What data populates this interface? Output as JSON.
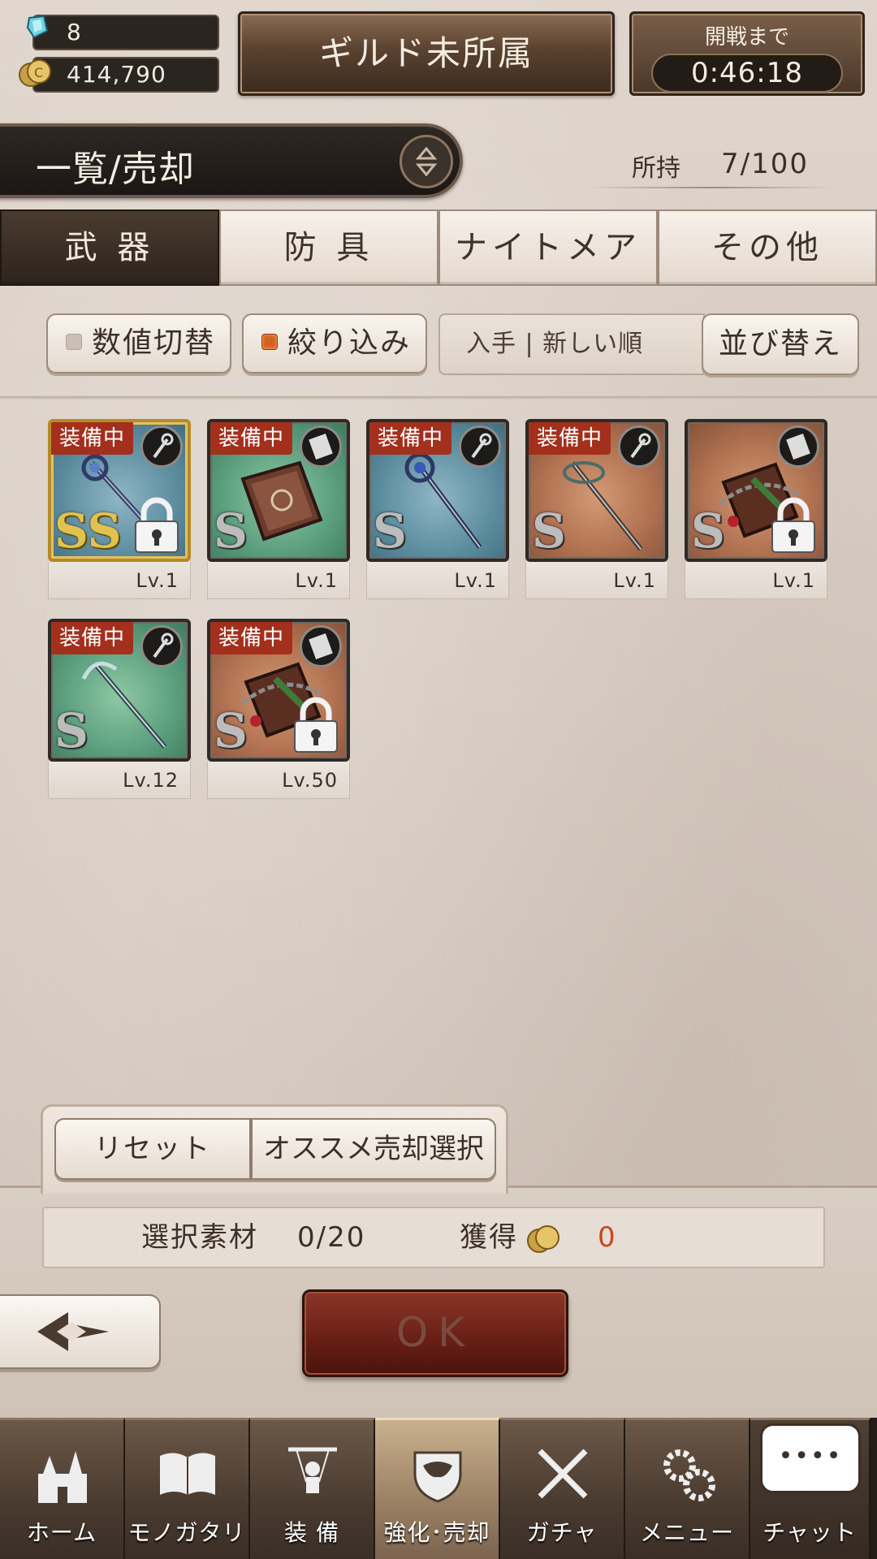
{
  "header": {
    "gems": "8",
    "gold": "414,790",
    "guild_status": "ギルド未所属",
    "battle_label": "開戦まで",
    "battle_timer": "0:46:18"
  },
  "title": {
    "text": "一覧/売却",
    "owned_label": "所持",
    "owned_value": "7/100"
  },
  "tabs": [
    {
      "label": "武 器",
      "active": true
    },
    {
      "label": "防 具",
      "active": false
    },
    {
      "label": "ナイトメア",
      "active": false
    },
    {
      "label": "その他",
      "active": false
    }
  ],
  "filters": {
    "value_toggle": "数値切替",
    "narrow": "絞り込み",
    "sort_field": "入手 | 新しい順",
    "sort_button": "並び替え"
  },
  "items": [
    {
      "equipped": "装備中",
      "rank": "SS",
      "level": "Lv.1",
      "bg": "blue",
      "locked": true,
      "type": "staff-icon"
    },
    {
      "equipped": "装備中",
      "rank": "S",
      "level": "Lv.1",
      "bg": "green",
      "locked": false,
      "type": "book-icon"
    },
    {
      "equipped": "装備中",
      "rank": "S",
      "level": "Lv.1",
      "bg": "blue",
      "locked": false,
      "type": "staff-icon"
    },
    {
      "equipped": "装備中",
      "rank": "S",
      "level": "Lv.1",
      "bg": "orange",
      "locked": false,
      "type": "staff-icon"
    },
    {
      "equipped": "",
      "rank": "S",
      "level": "Lv.1",
      "bg": "orange",
      "locked": true,
      "type": "book-icon"
    },
    {
      "equipped": "装備中",
      "rank": "S",
      "level": "Lv.12",
      "bg": "green",
      "locked": false,
      "type": "staff-icon"
    },
    {
      "equipped": "装備中",
      "rank": "S",
      "level": "Lv.50",
      "bg": "orange",
      "locked": true,
      "type": "book-icon"
    }
  ],
  "actions": {
    "reset": "リセット",
    "recommend": "オススメ売却選択"
  },
  "summary": {
    "selected_label": "選択素材",
    "selected_value": "0/20",
    "gain_label": "獲得",
    "gain_value": "0"
  },
  "ok_label": "OK",
  "nav": [
    {
      "label": "ホーム",
      "icon": "castle-icon",
      "active": false
    },
    {
      "label": "モノガタリ",
      "icon": "open-book-icon",
      "active": false
    },
    {
      "label": "装 備",
      "icon": "puppet-icon",
      "active": false
    },
    {
      "label": "強化･売却",
      "icon": "shield-mask-icon",
      "active": true
    },
    {
      "label": "ガチャ",
      "icon": "crossed-swords-icon",
      "active": false
    },
    {
      "label": "メニュー",
      "icon": "gears-icon",
      "active": false
    },
    {
      "label": "チャット",
      "icon": "chat-bubble-icon",
      "active": false
    }
  ],
  "colors": {
    "accent_red": "#a3301d",
    "ok_red": "#6a2017",
    "gain_orange": "#c9471f",
    "checkbox_on": "#d4621e"
  }
}
